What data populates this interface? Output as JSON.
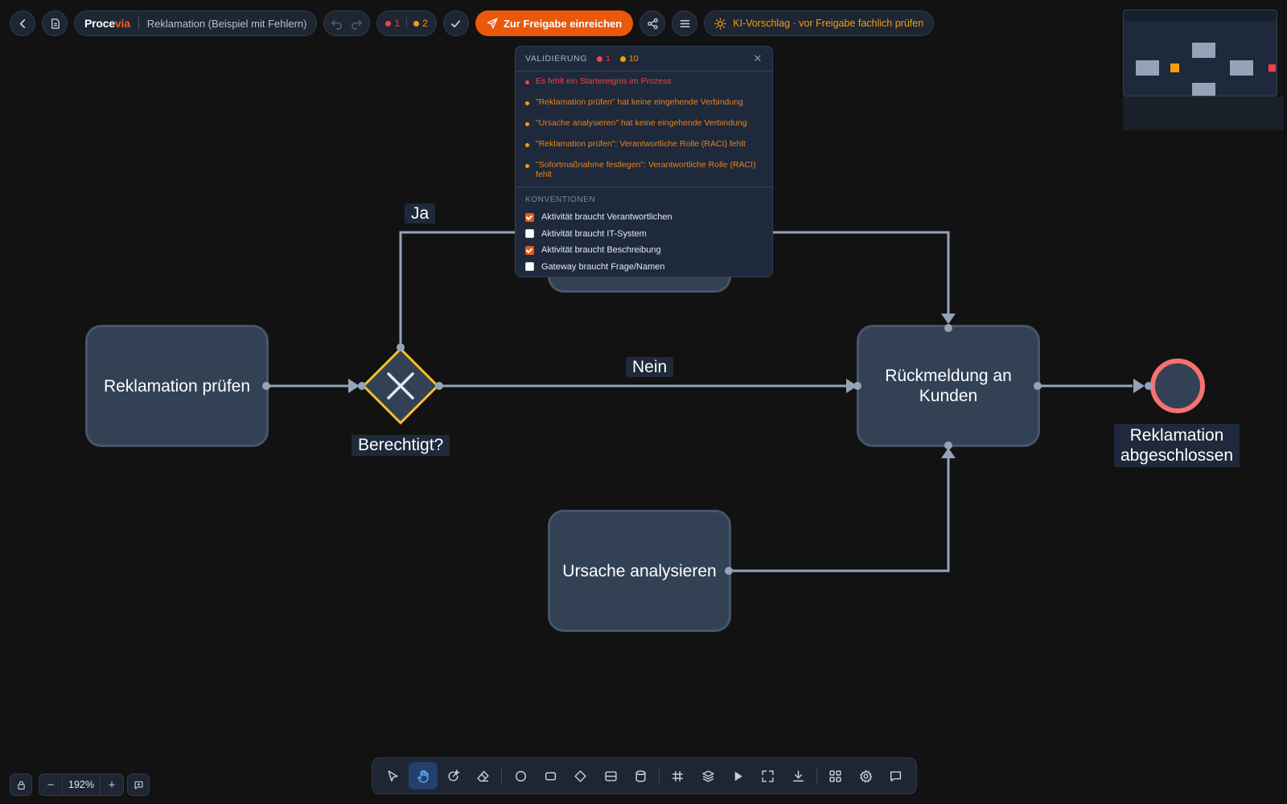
{
  "header": {
    "back_icon": "chevron-left-icon",
    "doc_icon": "document-icon",
    "brand_prefix": "Proce",
    "brand_suffix": "via",
    "document_title": "Reklamation (Beispiel mit Fehlern)",
    "error_count": "1",
    "warning_count": "2",
    "submit_label": "Zur Freigabe einreichen",
    "ai_suggestion": "KI-Vorschlag · vor Freigabe fachlich prüfen",
    "colors": {
      "accent": "#ea580c",
      "error": "#ef4444",
      "warning": "#f59e0b"
    }
  },
  "diagram": {
    "tasks": {
      "check": "Reklamation prüfen",
      "feedback": "Rückmeldung an Kunden",
      "analyze": "Ursache analysieren"
    },
    "gateway_label": "Berechtigt?",
    "flow_labels": {
      "yes": "Ja",
      "no": "Nein"
    },
    "end_event_label": "Reklamation abgeschlossen"
  },
  "validation": {
    "title": "VALIDIERUNG",
    "error_count": "1",
    "warning_count": "10",
    "close_icon": "close-icon",
    "issues": [
      {
        "severity": "error",
        "text": "Es fehlt ein Startereignis im Prozess"
      },
      {
        "severity": "warning",
        "text": "\"Reklamation prüfen\" hat keine eingehende Verbindung"
      },
      {
        "severity": "warning",
        "text": "\"Ursache analysieren\" hat keine eingehende Verbindung"
      },
      {
        "severity": "warning",
        "text": "\"Reklamation prüfen\": Verantwortliche Rolle (RACI) fehlt"
      },
      {
        "severity": "warning",
        "text": "\"Sofortmaßnahme festlegen\": Verantwortliche Rolle (RACI) fehlt"
      }
    ],
    "conventions_title": "KONVENTIONEN",
    "conventions": [
      {
        "label": "Aktivität braucht Verantwortlichen",
        "checked": true
      },
      {
        "label": "Aktivität braucht IT-System",
        "checked": false
      },
      {
        "label": "Aktivität braucht Beschreibung",
        "checked": true
      },
      {
        "label": "Gateway braucht Frage/Namen",
        "checked": false
      }
    ]
  },
  "toolbar": {
    "tools": [
      "cursor-icon",
      "hand-icon",
      "magic-connect-icon",
      "eraser-icon",
      "circle-icon",
      "rectangle-icon",
      "diamond-icon",
      "lane-icon",
      "database-icon",
      "grid-icon",
      "layers-icon",
      "play-icon",
      "fit-screen-icon",
      "download-icon",
      "apps-icon",
      "settings-icon",
      "comment-icon"
    ],
    "active_tool": "hand-icon"
  },
  "zoom": {
    "lock_icon": "lock-icon",
    "decrease": "−",
    "level": "192%",
    "increase": "+",
    "feedback_icon": "feedback-icon"
  }
}
